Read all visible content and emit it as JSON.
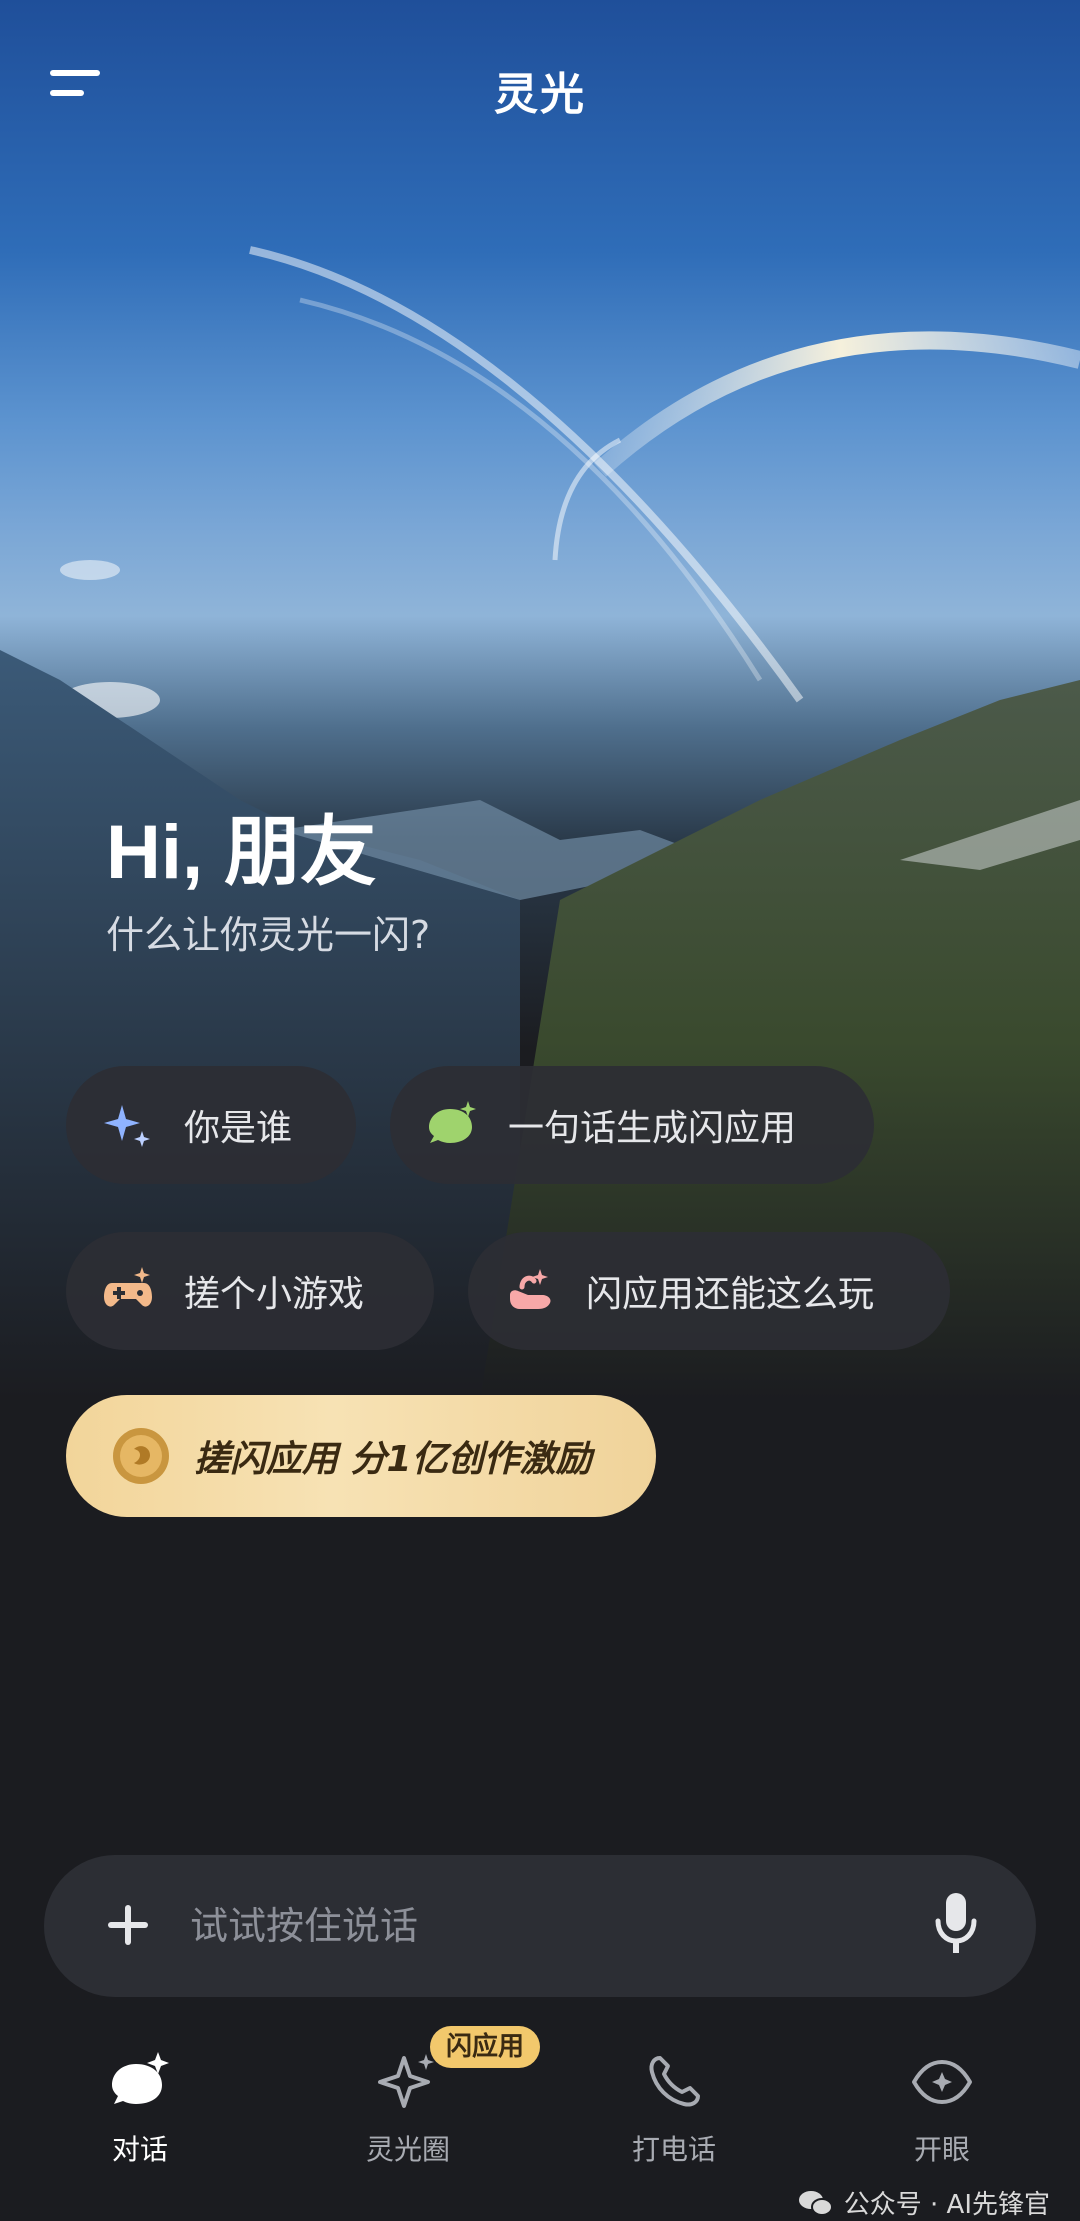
{
  "header": {
    "title": "灵光"
  },
  "hero": {
    "greeting": "Hi, 朋友",
    "subtitle": "什么让你灵光一闪?"
  },
  "suggestions": [
    {
      "label": "你是谁",
      "icon": "sparkle-icon"
    },
    {
      "label": "一句话生成闪应用",
      "icon": "chat-bubble-icon"
    },
    {
      "label": "搓个小游戏",
      "icon": "gamepad-icon"
    },
    {
      "label": "闪应用还能这么玩",
      "icon": "hand-icon"
    }
  ],
  "promo": {
    "label": "搓闪应用 分1亿创作激励",
    "icon": "gold-medal-icon"
  },
  "input": {
    "placeholder": "试试按住说话"
  },
  "tabs": [
    {
      "label": "对话",
      "icon": "chat-icon",
      "active": true
    },
    {
      "label": "灵光圈",
      "icon": "sparkle-star-icon",
      "badge": "闪应用"
    },
    {
      "label": "打电话",
      "icon": "phone-icon"
    },
    {
      "label": "开眼",
      "icon": "eye-icon"
    }
  ],
  "watermark": "公众号 · AI先锋官",
  "colors": {
    "accent_gold": "#f2c86c",
    "background": "#1b1c20",
    "chip": "#2c2e34"
  }
}
